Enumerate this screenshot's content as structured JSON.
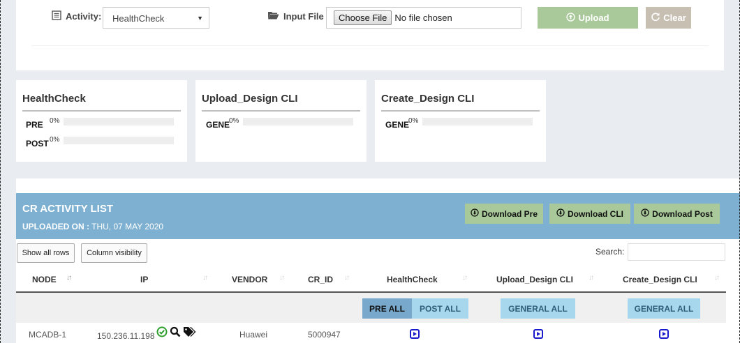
{
  "upload": {
    "activity_label": "Activity:",
    "activity_value": "HealthCheck",
    "input_file_label": "Input File :",
    "choose_file_label": "Choose File",
    "no_file_label": "No file chosen",
    "upload_label": "Upload",
    "clear_label": "Clear"
  },
  "progress_cards": [
    {
      "title": "HealthCheck",
      "rows": [
        {
          "name": "PRE",
          "pct": "0%",
          "value": 0
        },
        {
          "name": "POST",
          "pct": "0%",
          "value": 0
        }
      ]
    },
    {
      "title": "Upload_Design CLI",
      "rows": [
        {
          "name": "GENE",
          "pct": "0%",
          "value": 0
        }
      ]
    },
    {
      "title": "Create_Design CLI",
      "rows": [
        {
          "name": "GENE",
          "pct": "0%",
          "value": 0
        }
      ]
    }
  ],
  "activity_list": {
    "title": "CR ACTIVITY LIST",
    "uploaded_label": "UPLOADED ON :",
    "uploaded_date": "THU, 07 MAY 2020",
    "download_pre": "Download Pre",
    "download_cli": "Download CLI",
    "download_post": "Download Post",
    "show_all_rows": "Show all rows",
    "column_visibility": "Column visibility",
    "search_label": "Search:",
    "search_value": "",
    "columns": [
      "NODE",
      "IP",
      "VENDOR",
      "CR_ID",
      "HealthCheck",
      "Upload_Design CLI",
      "Create_Design CLI"
    ],
    "pre_all": "PRE ALL",
    "post_all": "POST ALL",
    "general_all_upload": "GENERAL ALL",
    "general_all_create": "GENERAL ALL",
    "rows": [
      {
        "node": "MCADB-1",
        "ip": "150.236.11.198",
        "vendor": "Huawei",
        "cr_id": "5000947"
      }
    ]
  },
  "colors": {
    "header_blue": "#7eb0d1",
    "upload_green": "#a9c99b",
    "clear_tan": "#c8bfb3",
    "play_blue": "#1a1acc",
    "status_green": "#2e9e2e"
  }
}
